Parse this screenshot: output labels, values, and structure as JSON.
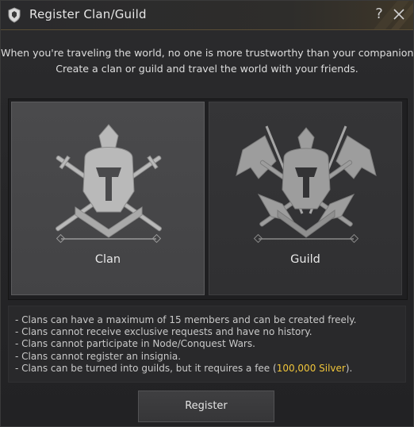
{
  "window": {
    "title": "Register Clan/Guild",
    "title_icon": "shield-crest-icon",
    "help_label": "?",
    "close_icon": "close-icon",
    "accent_color": "#5a4d35"
  },
  "intro": {
    "line1": "When you're traveling the world, no one is more trustworthy than your companions.",
    "line2": "Create a clan or guild and travel the world with your friends."
  },
  "options": {
    "clan": {
      "label": "Clan",
      "icon": "knight-helmet-crossed-swords-icon",
      "selected": true
    },
    "guild": {
      "label": "Guild",
      "icon": "knight-helmet-banners-icon",
      "selected": false
    }
  },
  "notes": {
    "line1": "- Clans can have a maximum of 15 members and can be created freely.",
    "line2": "- Clans cannot receive exclusive requests and have no history.",
    "line3": "- Clans cannot participate in Node/Conquest Wars.",
    "line4": "- Clans cannot register an insignia.",
    "line5_prefix": "- Clans can be turned into guilds, but it requires a fee (",
    "line5_highlight": "100,000 Silver",
    "line5_suffix": ").",
    "highlight_color": "#f0c53a"
  },
  "register_button": {
    "label": "Register"
  }
}
